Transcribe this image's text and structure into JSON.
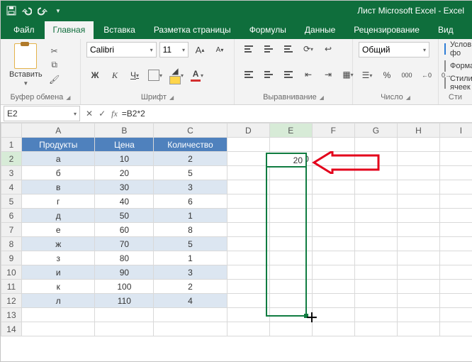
{
  "title": "Лист Microsoft Excel - Excel",
  "tabs": {
    "file": "Файл",
    "home": "Главная",
    "insert": "Вставка",
    "layout": "Разметка страницы",
    "formulas": "Формулы",
    "data": "Данные",
    "review": "Рецензирование",
    "view": "Вид"
  },
  "ribbon": {
    "clipboard": {
      "paste": "Вставить",
      "group": "Буфер обмена"
    },
    "font": {
      "name": "Calibri",
      "size": "11",
      "bold": "Ж",
      "italic": "К",
      "underline": "Ч",
      "group": "Шрифт",
      "grow": "A",
      "shrink": "A"
    },
    "alignment": {
      "group": "Выравнивание"
    },
    "number": {
      "format": "Общий",
      "group": "Число"
    },
    "styles": {
      "cond": "Условное фо",
      "table": "Форматиров",
      "cell": "Стили ячеек",
      "group": "Сти"
    }
  },
  "namebox": "E2",
  "formula": "=B2*2",
  "columns": [
    "A",
    "B",
    "C",
    "D",
    "E",
    "F",
    "G",
    "H",
    "I"
  ],
  "headers": {
    "A": "Продукты",
    "B": "Цена",
    "C": "Количество"
  },
  "rows": [
    {
      "n": 1
    },
    {
      "n": 2,
      "A": "а",
      "B": "10",
      "C": "2",
      "E": "20"
    },
    {
      "n": 3,
      "A": "б",
      "B": "20",
      "C": "5"
    },
    {
      "n": 4,
      "A": "в",
      "B": "30",
      "C": "3"
    },
    {
      "n": 5,
      "A": "г",
      "B": "40",
      "C": "6"
    },
    {
      "n": 6,
      "A": "д",
      "B": "50",
      "C": "1"
    },
    {
      "n": 7,
      "A": "е",
      "B": "60",
      "C": "8"
    },
    {
      "n": 8,
      "A": "ж",
      "B": "70",
      "C": "5"
    },
    {
      "n": 9,
      "A": "з",
      "B": "80",
      "C": "1"
    },
    {
      "n": 10,
      "A": "и",
      "B": "90",
      "C": "3"
    },
    {
      "n": 11,
      "A": "к",
      "B": "100",
      "C": "2"
    },
    {
      "n": 12,
      "A": "л",
      "B": "110",
      "C": "4"
    },
    {
      "n": 13
    },
    {
      "n": 14
    }
  ],
  "active_value": "20"
}
